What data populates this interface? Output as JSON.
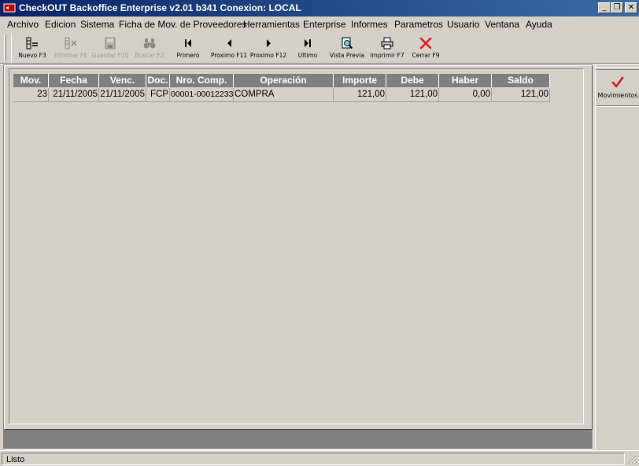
{
  "window": {
    "title": "CheckOUT Backoffice Enterprise v2.01 b341 Conexion: LOCAL",
    "minimize": "_",
    "restore": "❐",
    "close": "✕"
  },
  "menu": [
    "Archivo",
    "Edicion",
    "Sistema",
    "Ficha de Mov. de Proveedores",
    "Herramientas",
    "Enterprise",
    "Informes",
    "Parametros",
    "Usuario",
    "Ventana",
    "Ayuda"
  ],
  "toolbar": {
    "nuevo": "Nuevo F3",
    "eliminar": "Eliminar F6",
    "guardar": "Guardar F10",
    "buscar": "Buscar F2",
    "primero": "Primero",
    "prox11": "Proximo F11",
    "prox12": "Proximo F12",
    "ultimo": "Ultimo",
    "vista": "Vista Previa",
    "imprimir": "Imprimir F7",
    "cerrar": "Cerrar F9"
  },
  "grid": {
    "columns": [
      "Mov.",
      "Fecha",
      "Venc.",
      "Doc.",
      "Nro. Comp.",
      "Operación",
      "Importe",
      "Debe",
      "Haber",
      "Saldo"
    ],
    "rows": [
      [
        "23",
        "21/11/2005",
        "21/11/2005",
        "FCP",
        "00001-00012233",
        "COMPRA",
        "121,00",
        "121,00",
        "0,00",
        "121,00"
      ]
    ]
  },
  "side_panel": {
    "movimientos": "Movimientos"
  },
  "status": {
    "text": "Listo"
  },
  "colors": {
    "title_start": "#0a246a",
    "title_end": "#3a6ea5",
    "face": "#d4d0c8",
    "header": "#808080",
    "close_red": "#e02020",
    "check_red": "#d02020"
  }
}
